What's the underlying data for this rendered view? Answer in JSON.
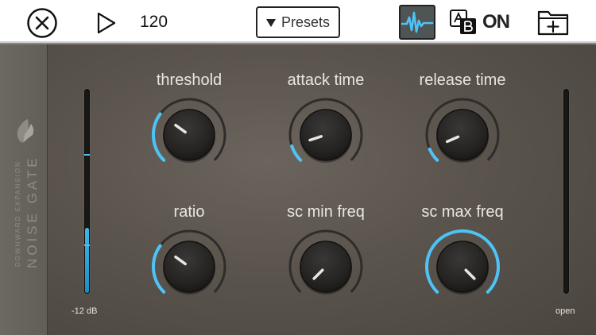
{
  "toolbar": {
    "tempo": "120",
    "presets_label": "Presets",
    "ab_on_label": "ON"
  },
  "plugin": {
    "subtitle": "DOWNWARD EXPANSION",
    "title": "NOISE GATE",
    "input_meter_label": "-12 dB",
    "output_meter_label": "open",
    "input_meter_level": 0.32,
    "accent_color": "#4fc3f7",
    "knobs": [
      {
        "label": "threshold",
        "value": 0.3
      },
      {
        "label": "attack time",
        "value": 0.1
      },
      {
        "label": "release time",
        "value": 0.08
      },
      {
        "label": "ratio",
        "value": 0.3
      },
      {
        "label": "sc min freq",
        "value": 0.0
      },
      {
        "label": "sc max freq",
        "value": 1.0
      }
    ]
  }
}
